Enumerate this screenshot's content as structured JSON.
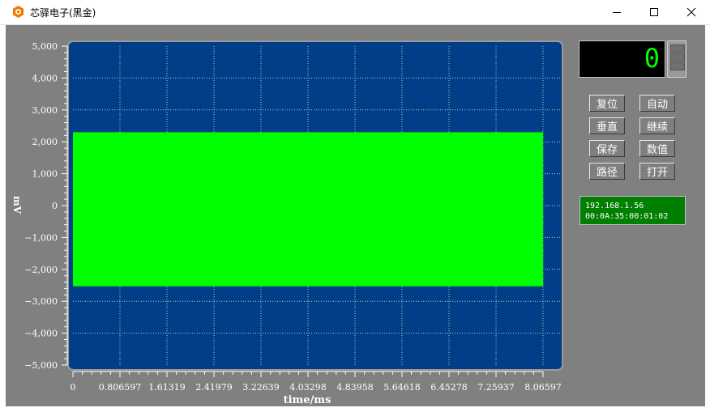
{
  "window": {
    "title": "芯驿电子(黑金)",
    "minimize_glyph": "—",
    "maximize_glyph": "☐",
    "close_glyph": "✕"
  },
  "counter": {
    "value": "0"
  },
  "buttons": {
    "reset": "复位",
    "auto": "自动",
    "vertical": "垂直",
    "continue": "继续",
    "save": "保存",
    "value": "数值",
    "path": "路径",
    "open": "打开"
  },
  "network": {
    "ip": "192.168.1.56",
    "mac": "00:0A:35:00:01:02"
  },
  "colors": {
    "plot_background": "#003f87",
    "signal": "#00ff00",
    "panel": "#808080",
    "counter_digits": "#00ff00",
    "net_panel": "#007f00"
  },
  "chart_data": {
    "type": "area",
    "title": "",
    "xlabel": "time/ms",
    "ylabel": "mV",
    "xlim": [
      0,
      8.06597
    ],
    "ylim": [
      -5000,
      5000
    ],
    "x_ticks": [
      "0",
      "0.806597",
      "1.61319",
      "2.41979",
      "3.22639",
      "4.03298",
      "4.83958",
      "5.64618",
      "6.45278",
      "7.25937",
      "8.06597"
    ],
    "y_ticks": [
      "5,000",
      "4,000",
      "3,000",
      "2,000",
      "1,000",
      "0",
      "−1,000",
      "−2,000",
      "−3,000",
      "−4,000",
      "−5,000"
    ],
    "y_tick_values": [
      5000,
      4000,
      3000,
      2000,
      1000,
      0,
      -1000,
      -2000,
      -3000,
      -4000,
      -5000
    ],
    "grid": true,
    "series": [
      {
        "x_range": [
          0,
          8.06597
        ],
        "upper": 2300,
        "lower": -2530
      }
    ]
  }
}
